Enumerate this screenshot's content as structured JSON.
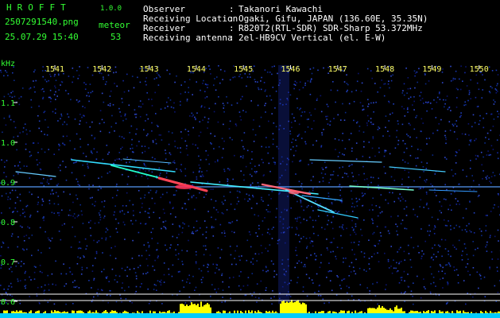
{
  "app": {
    "name": "HROFFT",
    "version": "1.0.0"
  },
  "file": {
    "name": "2507291540.png",
    "datetime": "25.07.29 15:40",
    "type_label": "meteor",
    "count": "53"
  },
  "info": [
    {
      "label": "Observer",
      "value": "Takanori Kawachi"
    },
    {
      "label": "Receiving Location",
      "value": "Ogaki, Gifu, JAPAN (136.60E, 35.35N)"
    },
    {
      "label": "Receiver",
      "value": "R820T2(RTL-SDR) SDR-Sharp 53.372MHz"
    },
    {
      "label": "Receiving antenna",
      "value": "2el-HB9CV Vertical (el. E-W)"
    }
  ],
  "axes": {
    "y_unit": "kHz",
    "y_ticks": [
      "1.1",
      "1.0",
      "0.9",
      "0.8",
      "0.7",
      "0.6"
    ],
    "x_ticks": [
      "1541",
      "1542",
      "1543",
      "1544",
      "1545",
      "1546",
      "1547",
      "1548",
      "1549",
      "1550"
    ]
  },
  "colors": {
    "background": "#000000",
    "header_text_green": "#33ff33",
    "header_text_white": "#ffffff",
    "noise_blue": "#1a2a8a",
    "trail_cyan": "#33ddff",
    "trail_hot": "#ff4455",
    "bottom_bar_cyan": "#00ccff",
    "bottom_bar_yellow": "#ffff00"
  }
}
